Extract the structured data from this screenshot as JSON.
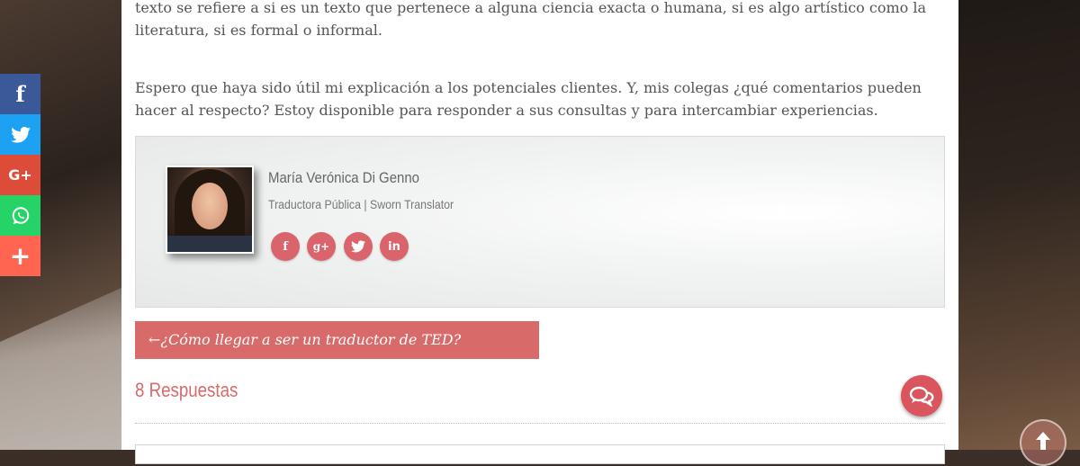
{
  "article": {
    "paragraph_1": "texto se refiere a si es un texto que pertenece a alguna ciencia exacta o humana, si es algo artístico como la literatura, si es formal o informal.",
    "paragraph_2": "Espero que haya sido útil mi explicación a los potenciales clientes. Y,  mis colegas ¿qué comentarios pueden hacer al respecto? Estoy disponible para responder a sus consultas y para intercambiar experiencias."
  },
  "author": {
    "name": "María Verónica Di Genno",
    "role": "Traductora Pública | Sworn Translator",
    "social_icons": [
      "facebook-icon",
      "google-plus-icon",
      "twitter-icon",
      "linkedin-icon"
    ],
    "social_glyphs": [
      "f",
      "g+",
      "t",
      "in"
    ]
  },
  "navigation": {
    "prev_arrow": "←",
    "prev_post": "¿Cómo llegar a ser un traductor de TED?"
  },
  "comments": {
    "count_label": "8 Respuestas"
  },
  "share_bar": {
    "buttons": [
      {
        "icon": "facebook-icon",
        "glyph": "f",
        "color": "#3b5998"
      },
      {
        "icon": "twitter-icon",
        "glyph": "t",
        "color": "#1da1f2"
      },
      {
        "icon": "google-plus-icon",
        "glyph": "G+",
        "color": "#dd4b39"
      },
      {
        "icon": "whatsapp-icon",
        "glyph": "w",
        "color": "#25d366"
      },
      {
        "icon": "plus-icon",
        "glyph": "+",
        "color": "#ff6550"
      }
    ]
  },
  "colors": {
    "accent": "#d96a6a",
    "text": "#555555"
  }
}
